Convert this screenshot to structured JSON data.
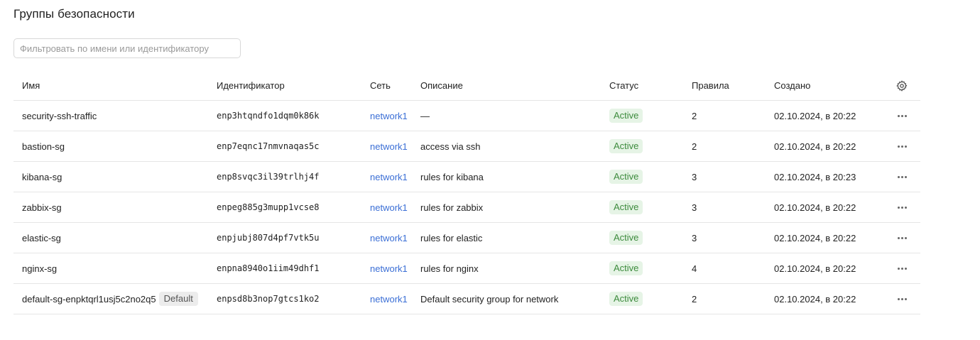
{
  "page": {
    "title": "Группы безопасности"
  },
  "filter": {
    "placeholder": "Фильтровать по имени или идентификатору"
  },
  "table": {
    "headers": {
      "name": "Имя",
      "id": "Идентификатор",
      "network": "Сеть",
      "description": "Описание",
      "status": "Статус",
      "rules": "Правила",
      "created": "Создано"
    },
    "rows": [
      {
        "name": "security-ssh-traffic",
        "badge": "",
        "id": "enp3htqndfo1dqm0k86k",
        "network": "network1",
        "description": "—",
        "status": "Active",
        "rules": "2",
        "created": "02.10.2024, в 20:22"
      },
      {
        "name": "bastion-sg",
        "badge": "",
        "id": "enp7eqnc17nmvnaqas5c",
        "network": "network1",
        "description": "access via ssh",
        "status": "Active",
        "rules": "2",
        "created": "02.10.2024, в 20:22"
      },
      {
        "name": "kibana-sg",
        "badge": "",
        "id": "enp8svqc3il39trlhj4f",
        "network": "network1",
        "description": "rules for kibana",
        "status": "Active",
        "rules": "3",
        "created": "02.10.2024, в 20:23"
      },
      {
        "name": "zabbix-sg",
        "badge": "",
        "id": "enpeg885g3mupp1vcse8",
        "network": "network1",
        "description": "rules for zabbix",
        "status": "Active",
        "rules": "3",
        "created": "02.10.2024, в 20:22"
      },
      {
        "name": "elastic-sg",
        "badge": "",
        "id": "enpjubj807d4pf7vtk5u",
        "network": "network1",
        "description": "rules for elastic",
        "status": "Active",
        "rules": "3",
        "created": "02.10.2024, в 20:22"
      },
      {
        "name": "nginx-sg",
        "badge": "",
        "id": "enpna8940o1iim49dhf1",
        "network": "network1",
        "description": "rules for nginx",
        "status": "Active",
        "rules": "4",
        "created": "02.10.2024, в 20:22"
      },
      {
        "name": "default-sg-enpktqrl1usj5c2no2q5",
        "badge": "Default",
        "id": "enpsd8b3nop7gtcs1ko2",
        "network": "network1",
        "description": "Default security group for network",
        "status": "Active",
        "rules": "2",
        "created": "02.10.2024, в 20:22"
      }
    ]
  },
  "colors": {
    "link": "#3b6fd6",
    "status_active_bg": "#e6f4e6",
    "status_active_text": "#3d8b3d"
  },
  "icons": {
    "settings": "gear-icon",
    "row_actions": "more-horizontal-icon"
  }
}
